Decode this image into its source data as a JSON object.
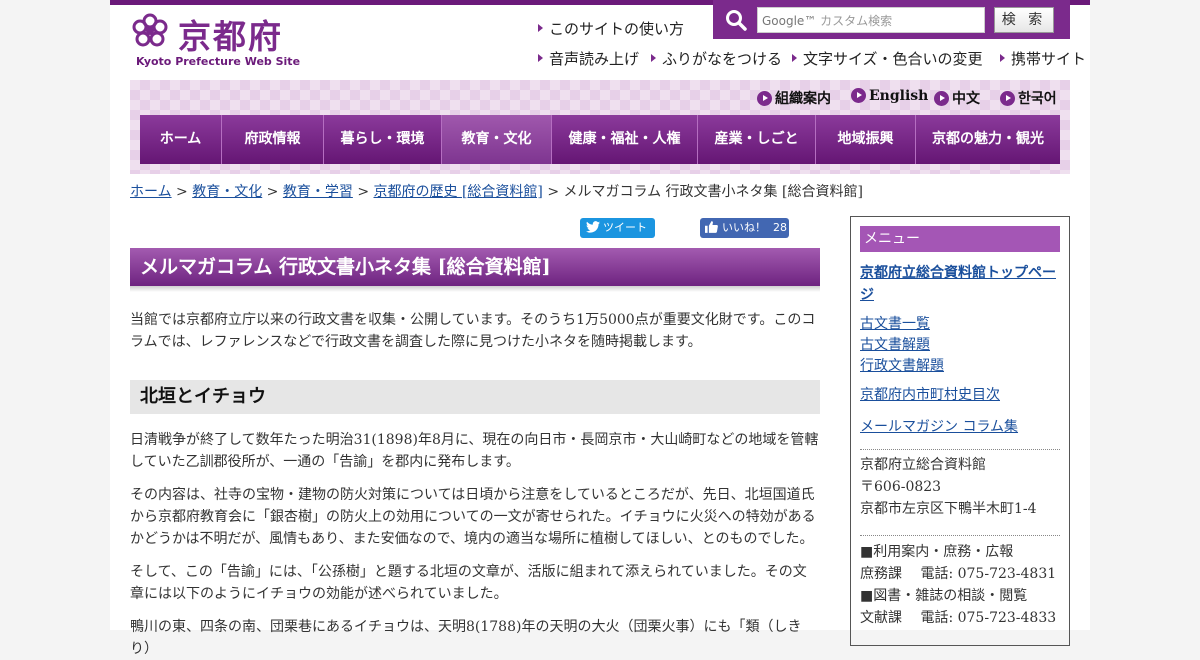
{
  "header": {
    "logo_text": "京都府",
    "logo_sub": "Kyoto Prefecture Web Site",
    "site_guide": "このサイトの使い方",
    "utility_links": [
      "音声読み上げ",
      "ふりがなをつける",
      "文字サイズ・色合いの変更",
      "携帯サイト"
    ],
    "search": {
      "google": "Google™",
      "placeholder": "カスタム検索",
      "button": "検 索"
    }
  },
  "lang_links": [
    "組織案内",
    "English",
    "中文",
    "한국어"
  ],
  "nav": [
    "ホーム",
    "府政情報",
    "暮らし・環境",
    "教育・文化",
    "健康・福祉・人権",
    "産業・しごと",
    "地域振興",
    "京都の魅力・観光"
  ],
  "nav_active": "教育・文化",
  "breadcrumb": {
    "links": [
      "ホーム",
      "教育・文化",
      "教育・学習",
      "京都府の歴史 [総合資料館]"
    ],
    "current": "メルマガコラム 行政文書小ネタ集 [総合資料館]"
  },
  "social": {
    "tweet": "ツイート",
    "like": "いいね！",
    "like_count": "28"
  },
  "main": {
    "title": "メルマガコラム 行政文書小ネタ集 [総合資料館]",
    "intro": "当館では京都府立庁以来の行政文書を収集・公開しています。そのうち1万5000点が重要文化財です。このコラムでは、レファレンスなどで行政文書を調査した際に見つけた小ネタを随時掲載します。",
    "section_title": "北垣とイチョウ",
    "paragraphs": [
      "日清戦争が終了して数年たった明治31(1898)年8月に、現在の向日市・長岡京市・大山崎町などの地域を管轄していた乙訓郡役所が、一通の「告諭」を郡内に発布します。",
      "その内容は、社寺の宝物・建物の防火対策については日頃から注意をしているところだが、先日、北垣国道氏から京都府教育会に「銀杏樹」の防火上の効用についての一文が寄せられた。イチョウに火災への特効があるかどうかは不明だが、風情もあり、また安価なので、境内の適当な場所に植樹してほしい、とのものでした。",
      "そして、この「告諭」には、「公孫樹」と題する北垣の文章が、活版に組まれて添えられていました。その文章には以下のようにイチョウの効能が述べられていました。",
      "鴨川の東、四条の南、団栗巷にあるイチョウは、天明8(1788)年の天明の大火（団栗火事）にも「類（しきり）"
    ]
  },
  "sidebar": {
    "heading": "メニュー",
    "top_link": "京都府立総合資料館トップページ",
    "links": [
      "古文書一覧",
      "古文書解題",
      "行政文書解題"
    ],
    "link2": "京都府内市町村史目次",
    "link3": "メールマガジン コラム集",
    "address": [
      "京都府立総合資料館",
      "〒606-0823",
      "京都市左京区下鴨半木町1-4"
    ],
    "contacts": [
      "■利用案内・庶務・広報",
      "庶務課　 電話: 075-723-4831",
      "■図書・雑誌の相談・閲覧",
      "文献課　 電話: 075-723-4833"
    ]
  }
}
